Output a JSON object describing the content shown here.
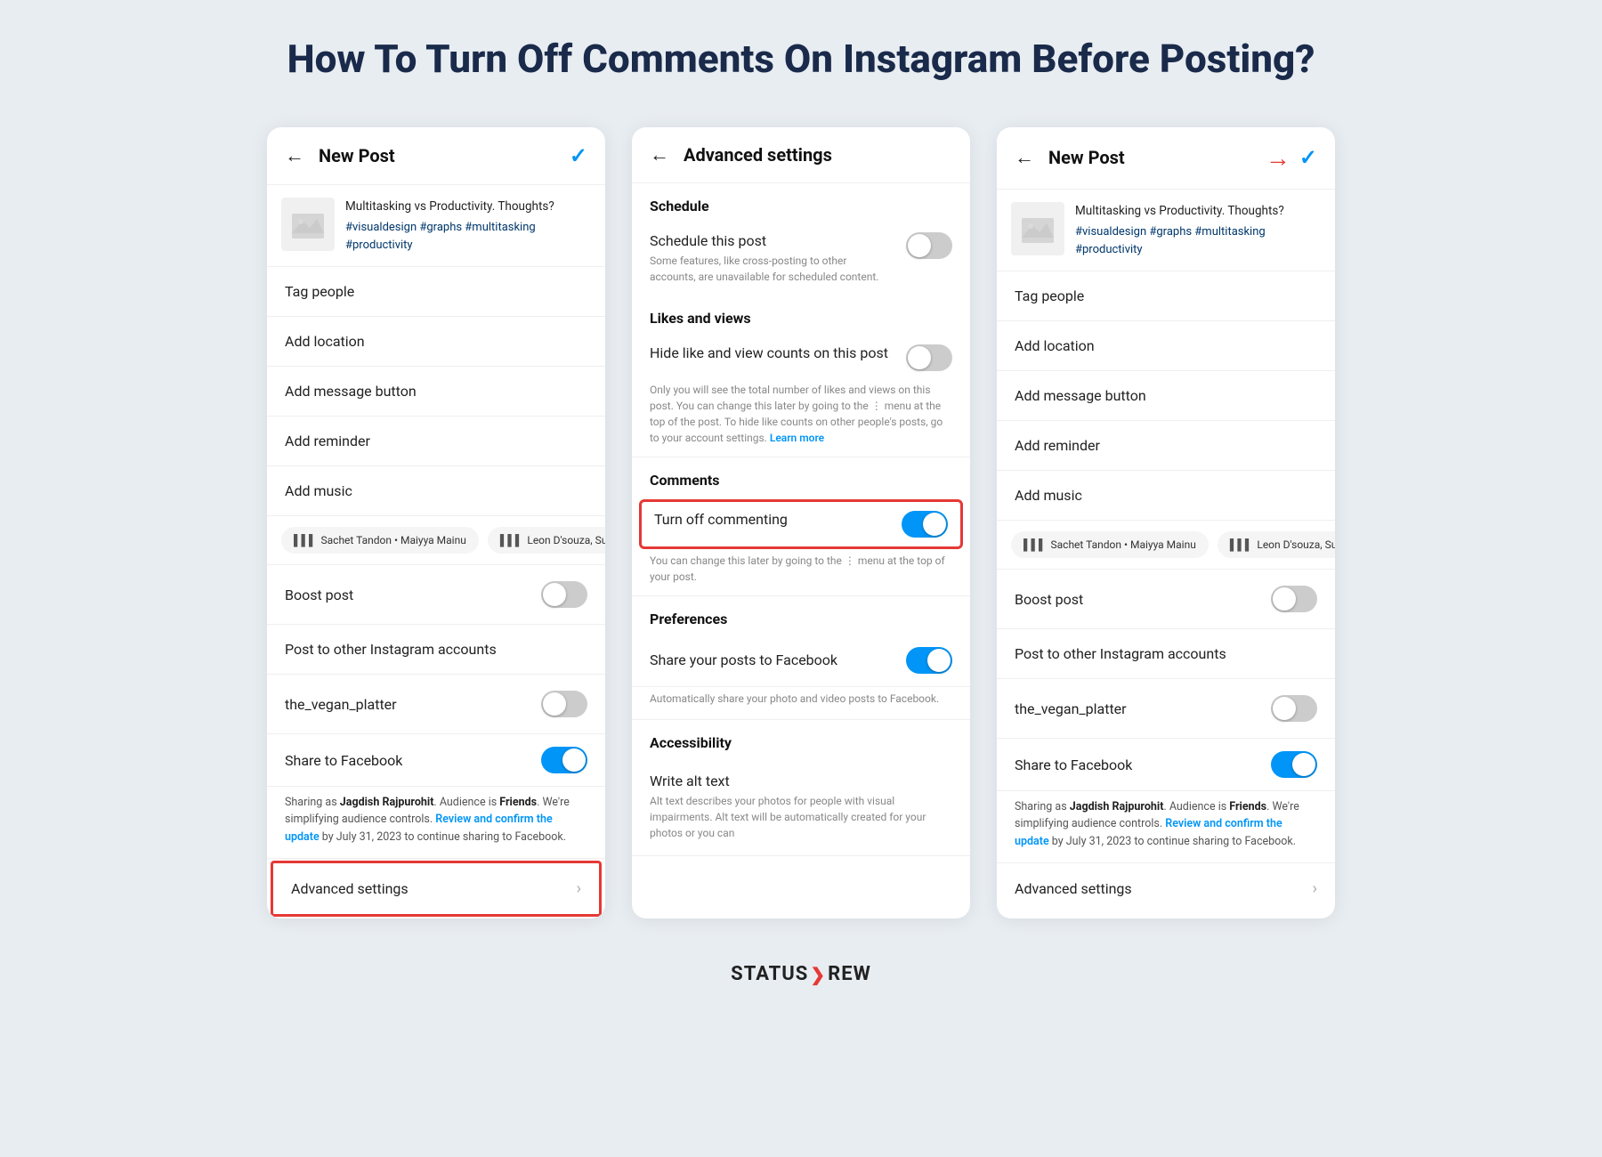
{
  "title": "How To Turn Off Comments On Instagram Before Posting?",
  "panels": {
    "left": {
      "header": {
        "back": "←",
        "title": "New Post",
        "check": "✓"
      },
      "post": {
        "caption": "Multitasking vs Productivity. Thoughts?",
        "hashtags": "#visualdesign #graphs #multitasking #productivity"
      },
      "menu_items": [
        {
          "label": "Tag people"
        },
        {
          "label": "Add location"
        },
        {
          "label": "Add message button"
        },
        {
          "label": "Add reminder"
        },
        {
          "label": "Add music"
        }
      ],
      "music_chips": [
        {
          "label": "Sachet Tandon • Maiyya Mainu"
        },
        {
          "label": "Leon D'souza, Suzanne"
        }
      ],
      "boost_label": "Boost post",
      "post_to_label": "Post to other Instagram accounts",
      "account_name": "the_vegan_platter",
      "share_fb_label": "Share to Facebook",
      "sharing_note_1": "Sharing as ",
      "sharing_bold_1": "Jagdish Rajpurohit",
      "sharing_note_2": ". Audience is ",
      "sharing_bold_2": "Friends",
      "sharing_note_3": ". We're simplifying audience controls. ",
      "sharing_link": "Review and confirm the update",
      "sharing_note_4": " by July 31, 2023 to continue sharing to Facebook.",
      "advanced_label": "Advanced settings"
    },
    "middle": {
      "header": {
        "back": "←",
        "title": "Advanced settings"
      },
      "schedule_title": "Schedule",
      "schedule_post_label": "Schedule this post",
      "schedule_note": "Some features, like cross-posting to other accounts, are unavailable for scheduled content.",
      "likes_title": "Likes and views",
      "hide_likes_label": "Hide like and view counts on this post",
      "hide_likes_note": "Only you will see the total number of likes and views on this post. You can change this later by going to the ⋮ menu at the top of the post. To hide like counts on other people's posts, go to your account settings.",
      "learn_more": "Learn more",
      "comments_title": "Comments",
      "turn_off_label": "Turn off commenting",
      "turn_off_note": "You can change this later by going to the ⋮ menu at the top of your post.",
      "preferences_title": "Preferences",
      "share_fb_label": "Share your posts to Facebook",
      "share_fb_note": "Automatically share your photo and video posts to Facebook.",
      "accessibility_title": "Accessibility",
      "alt_text_label": "Write alt text",
      "alt_text_note": "Alt text describes your photos for people with visual impairments. Alt text will be automatically created for your photos or you can"
    },
    "right": {
      "header": {
        "back": "←",
        "title": "New Post",
        "check": "✓",
        "arrow": "→"
      },
      "post": {
        "caption": "Multitasking vs Productivity. Thoughts?",
        "hashtags": "#visualdesign #graphs #multitasking #productivity"
      },
      "menu_items": [
        {
          "label": "Tag people"
        },
        {
          "label": "Add location"
        },
        {
          "label": "Add message button"
        },
        {
          "label": "Add reminder"
        },
        {
          "label": "Add music"
        }
      ],
      "music_chips": [
        {
          "label": "Sachet Tandon • Maiyya Mainu"
        },
        {
          "label": "Leon D'souza, Suzann..."
        }
      ],
      "boost_label": "Boost post",
      "post_to_label": "Post to other Instagram accounts",
      "account_name": "the_vegan_platter",
      "share_fb_label": "Share to Facebook",
      "sharing_note_1": "Sharing as ",
      "sharing_bold_1": "Jagdish Rajpurohit",
      "sharing_note_2": ". Audience is ",
      "sharing_bold_2": "Friends",
      "sharing_note_3": ". We're simplifying audience controls. ",
      "sharing_link": "Review and confirm the update",
      "sharing_note_4": " by July 31, 2023 to continue sharing to Facebook.",
      "advanced_label": "Advanced settings"
    }
  },
  "footer": {
    "logo_text": "STATUS",
    "logo_arrow": "❯",
    "logo_end": "REW"
  }
}
